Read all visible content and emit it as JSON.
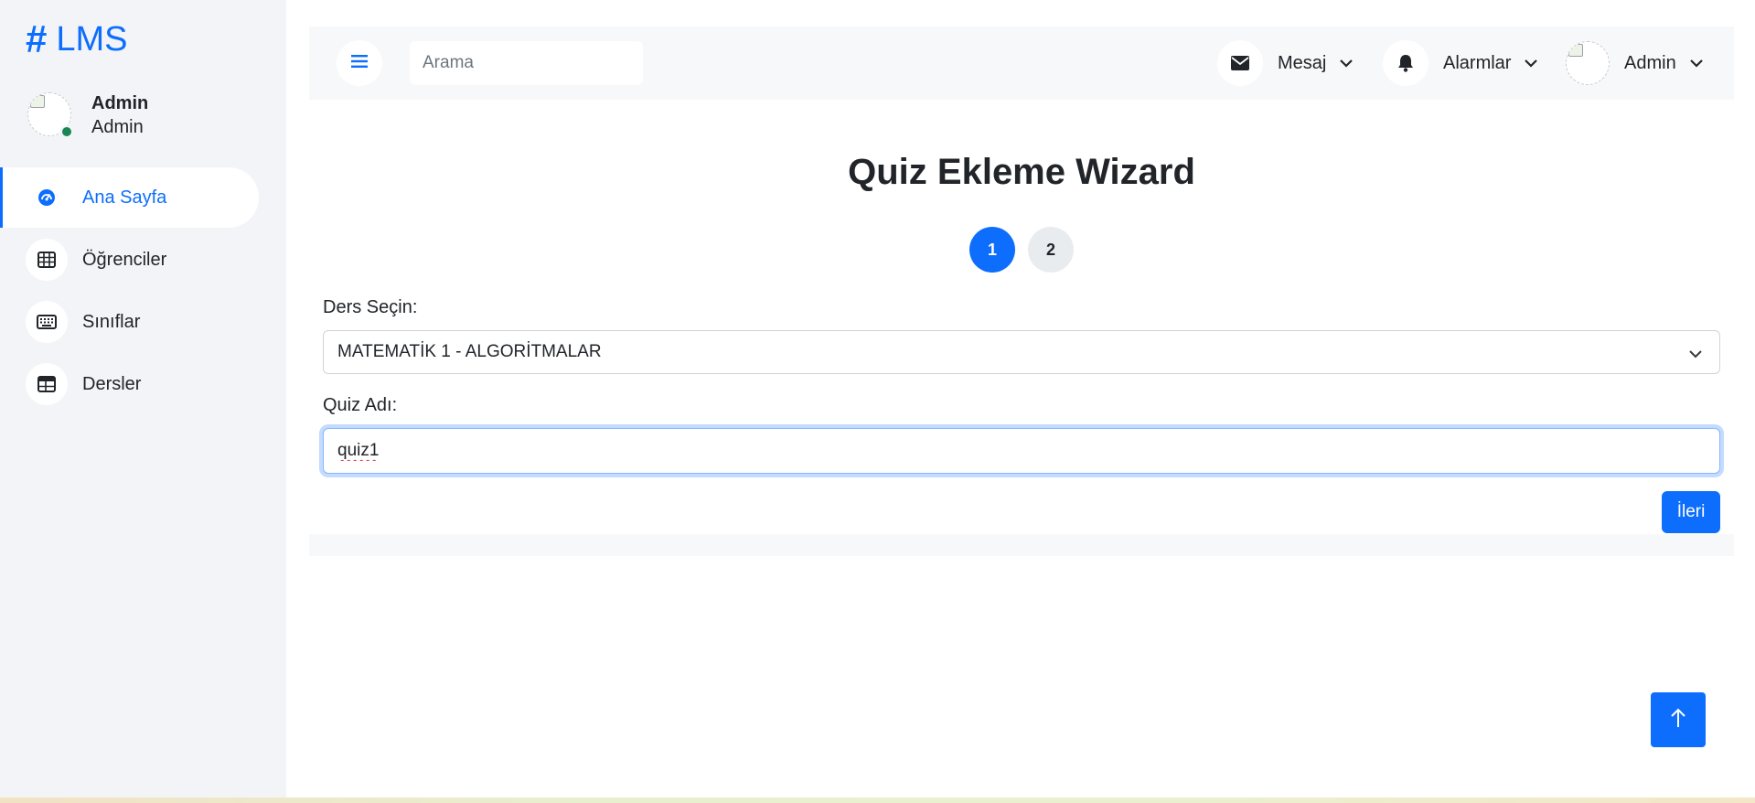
{
  "brand": {
    "symbol": "#",
    "name": "LMS"
  },
  "user": {
    "name": "Admin",
    "role": "Admin"
  },
  "sidebar": {
    "items": [
      {
        "label": "Ana Sayfa",
        "icon": "dashboard-gauge-icon",
        "active": true
      },
      {
        "label": "Öğrenciler",
        "icon": "table-grid-icon",
        "active": false
      },
      {
        "label": "Sınıflar",
        "icon": "keyboard-icon",
        "active": false
      },
      {
        "label": "Dersler",
        "icon": "table-list-icon",
        "active": false
      }
    ]
  },
  "topbar": {
    "menu_icon": "hamburger-menu-icon",
    "search_placeholder": "Arama",
    "messages_label": "Mesaj",
    "alerts_label": "Alarmlar",
    "account_label": "Admin"
  },
  "wizard": {
    "title": "Quiz Ekleme Wizard",
    "steps": [
      "1",
      "2"
    ],
    "active_step": 1,
    "course_label": "Ders Seçin:",
    "course_selected": "MATEMATİK 1 - ALGORİTMALAR",
    "quiz_name_label": "Quiz Adı:",
    "quiz_name_value": "quiz1",
    "next_label": "İleri"
  },
  "colors": {
    "accent": "#0d6efd",
    "sidebar_bg": "#f3f4f7",
    "online_status": "#198754"
  }
}
